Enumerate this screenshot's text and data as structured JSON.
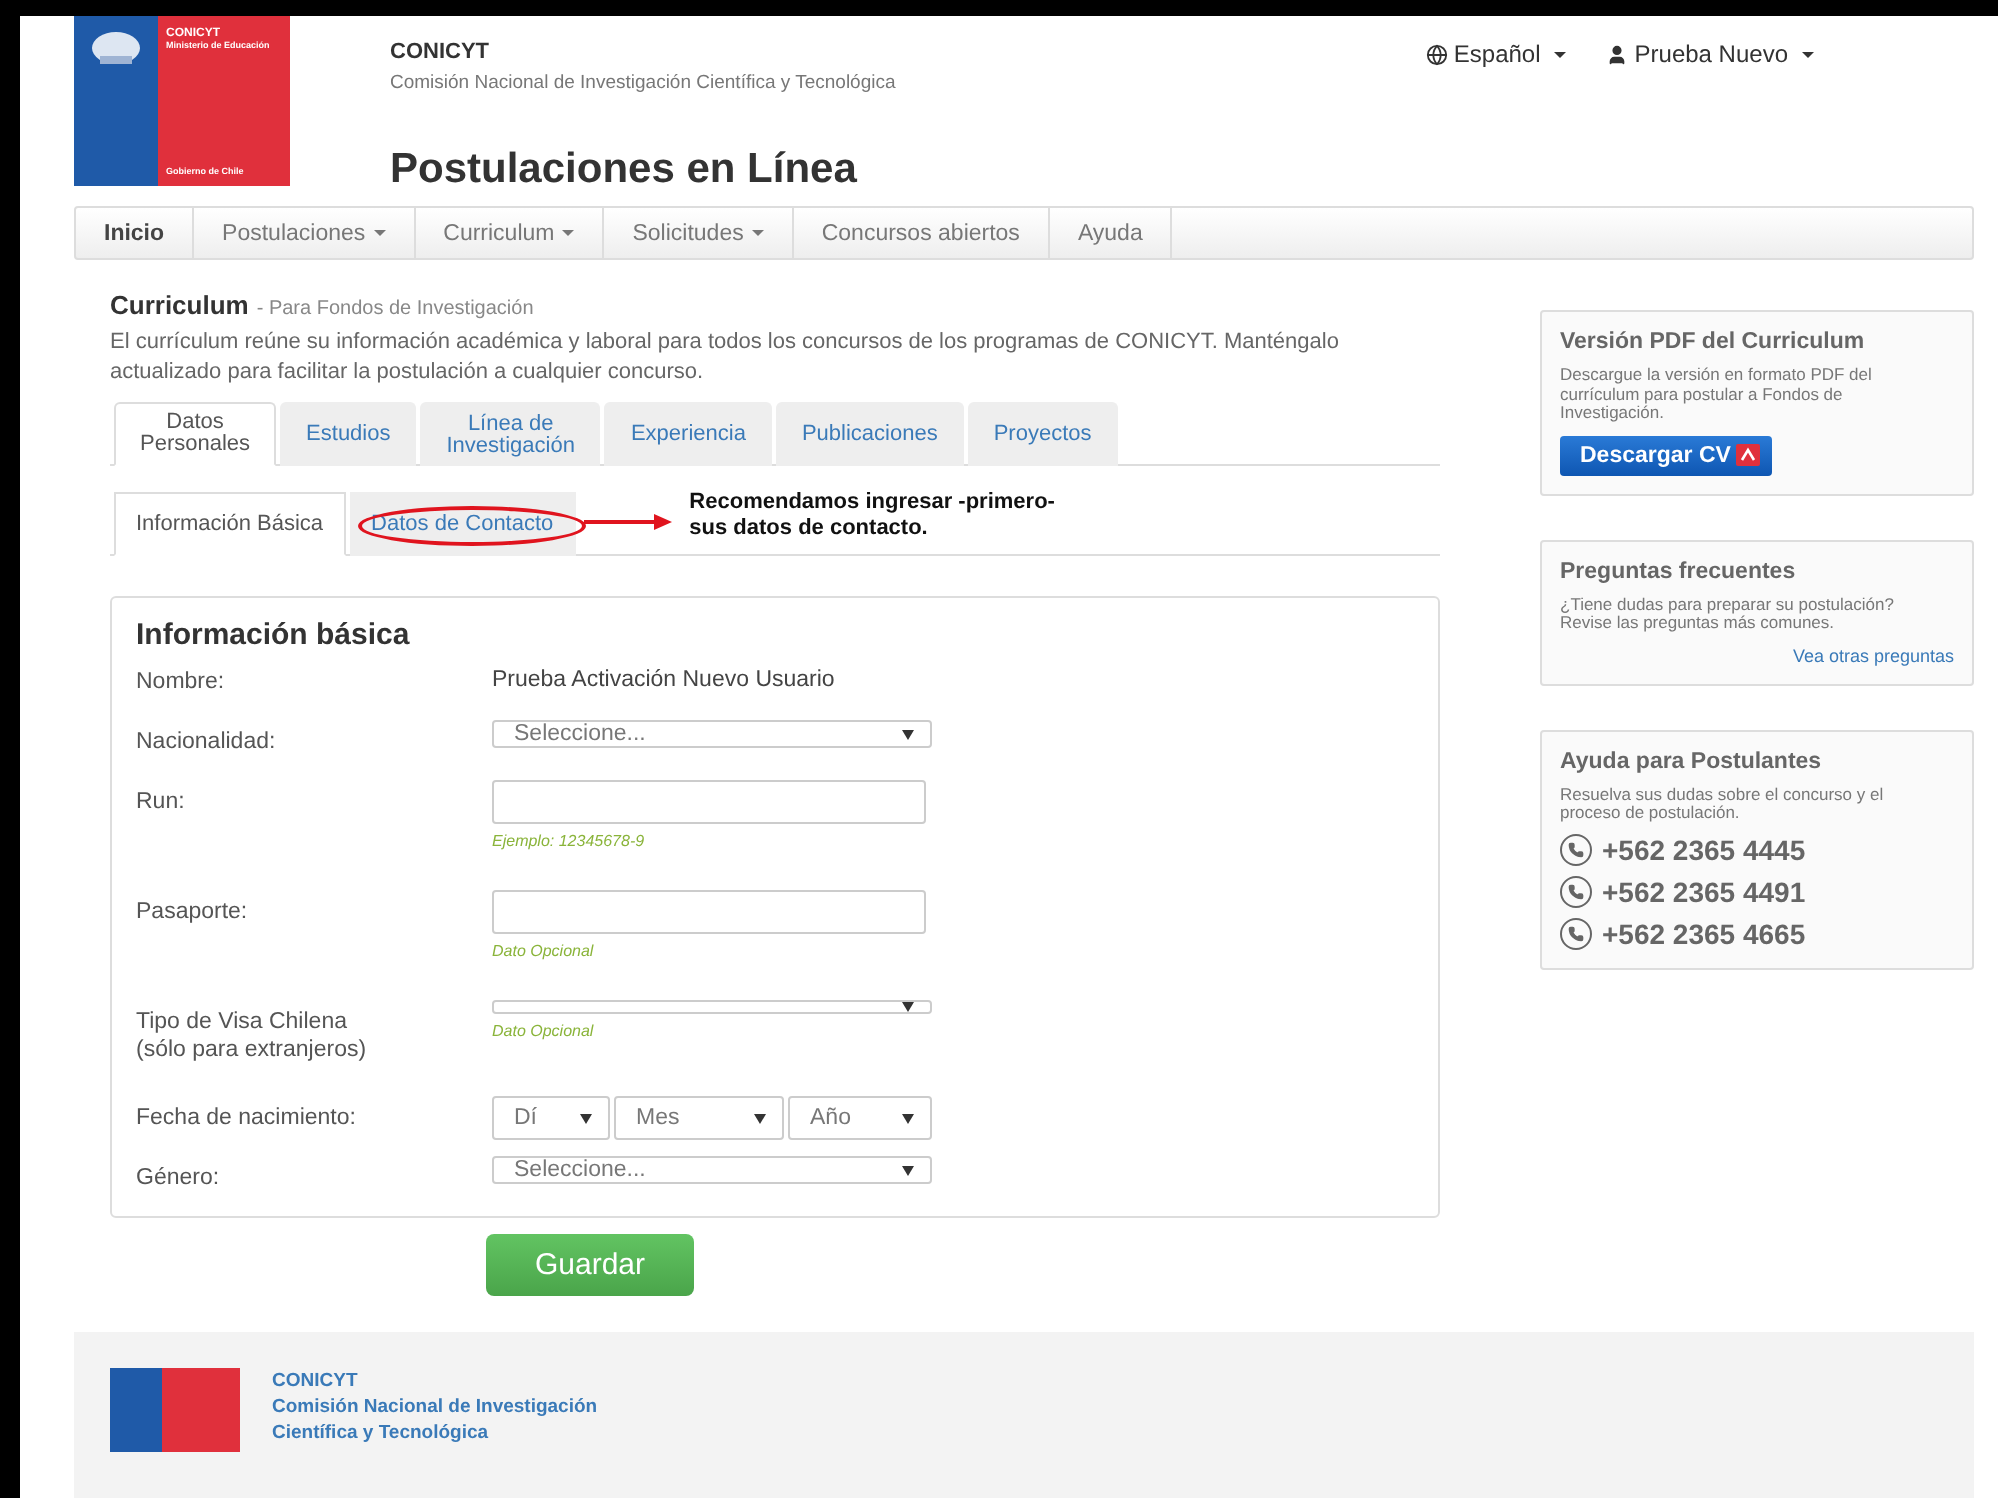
{
  "header": {
    "logo": {
      "name": "CONICYT",
      "ministry": "Ministerio de Educación",
      "government": "Gobierno de Chile"
    },
    "org": "CONICYT",
    "org_full": "Comisión Nacional de Investigación Científica y Tecnológica",
    "title": "Postulaciones en Línea",
    "language": "Español",
    "user": "Prueba Nuevo"
  },
  "nav": [
    {
      "label": "Inicio",
      "dropdown": false,
      "selected": true
    },
    {
      "label": "Postulaciones",
      "dropdown": true,
      "selected": false
    },
    {
      "label": "Curriculum",
      "dropdown": true,
      "selected": false
    },
    {
      "label": "Solicitudes",
      "dropdown": true,
      "selected": false
    },
    {
      "label": "Concursos abiertos",
      "dropdown": false,
      "selected": false
    },
    {
      "label": "Ayuda",
      "dropdown": false,
      "selected": false
    }
  ],
  "page": {
    "title": "Curriculum",
    "subtitle": "- Para Fondos de Investigación",
    "description": "El currículum reúne su información académica y laboral para todos los concursos de los programas de CONICYT. Manténgalo actualizado para facilitar la postulación a cualquier concurso."
  },
  "tabs": [
    {
      "lines": [
        "Datos",
        "Personales"
      ],
      "selected": true
    },
    {
      "lines": [
        "Estudios"
      ],
      "selected": false
    },
    {
      "lines": [
        "Línea de",
        "Investigación"
      ],
      "selected": false
    },
    {
      "lines": [
        "Experiencia"
      ],
      "selected": false
    },
    {
      "lines": [
        "Publicaciones"
      ],
      "selected": false
    },
    {
      "lines": [
        "Proyectos"
      ],
      "selected": false
    }
  ],
  "subtabs": [
    {
      "label": "Información Básica",
      "selected": true,
      "circled": false
    },
    {
      "label": "Datos de Contacto",
      "selected": false,
      "circled": true
    }
  ],
  "annotation": [
    "Recomendamos ingresar -primero-",
    "sus datos de contacto."
  ],
  "form": {
    "title": "Información básica",
    "fields": [
      {
        "kind": "text",
        "label": [
          "Nombre:"
        ],
        "value": "Prueba Activación Nuevo Usuario"
      },
      {
        "kind": "select",
        "label": [
          "Nacionalidad:"
        ],
        "placeholder": "Seleccione..."
      },
      {
        "kind": "input",
        "label": [
          "Run:"
        ],
        "hint": "Ejemplo: 12345678-9"
      },
      {
        "kind": "input",
        "label": [
          "Pasaporte:"
        ],
        "hint": "Dato Opcional"
      },
      {
        "kind": "select",
        "label": [
          "Tipo de Visa Chilena",
          "(sólo para extranjeros)"
        ],
        "hint": "Dato Opcional"
      },
      {
        "kind": "date",
        "label": [
          "Fecha de nacimiento:"
        ],
        "parts": [
          "Dí",
          "Mes",
          "Año"
        ]
      },
      {
        "kind": "select",
        "label": [
          "Género:"
        ],
        "placeholder": "Seleccione..."
      }
    ]
  },
  "save_button": "Guardar",
  "sidebar": [
    {
      "kind": "pdf",
      "title": "Versión PDF del Curriculum",
      "text": "Descargue la versión en formato PDF del currículum para postular a Fondos de Investigación.",
      "button": "Descargar CV"
    },
    {
      "kind": "faq",
      "title": "Preguntas frecuentes",
      "text": "¿Tiene dudas para preparar su postulación? Revise las preguntas más comunes.",
      "link": "Vea otras preguntas"
    },
    {
      "kind": "help",
      "title": "Ayuda para Postulantes",
      "text": "Resuelva sus dudas sobre el concurso y el proceso de postulación.",
      "phones": [
        "+562 2365 4445",
        "+562 2365 4491",
        "+562 2365 4665"
      ]
    }
  ],
  "footer": {
    "lines": [
      "CONICYT",
      "Comisión Nacional de Investigación",
      "Científica y Tecnológica"
    ]
  }
}
